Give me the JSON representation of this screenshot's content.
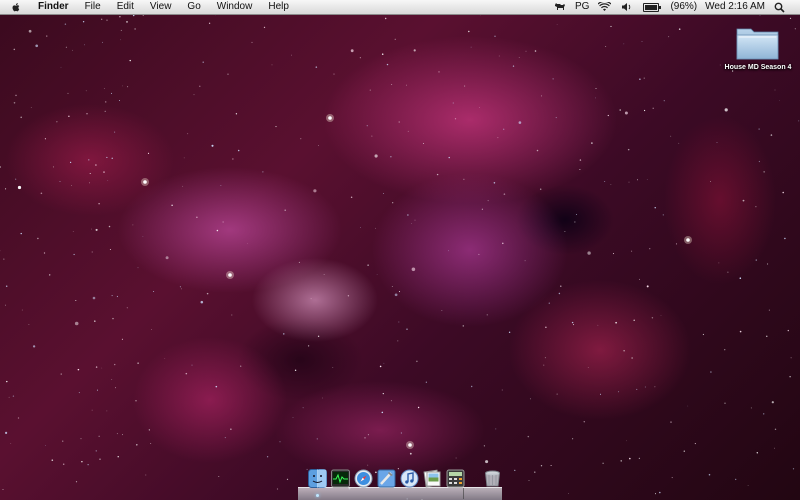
{
  "menubar": {
    "apple_icon": "apple-logo-icon",
    "items": [
      {
        "label": "Finder",
        "bold": true
      },
      {
        "label": "File"
      },
      {
        "label": "Edit"
      },
      {
        "label": "View"
      },
      {
        "label": "Go"
      },
      {
        "label": "Window"
      },
      {
        "label": "Help"
      }
    ],
    "status": {
      "dog_icon": "dog-icon",
      "input_label": "PG",
      "wifi_icon": "wifi-icon",
      "volume_icon": "volume-icon",
      "battery_icon": "battery-icon",
      "battery_level": 0.96,
      "battery_text": "(96%)",
      "clock": "Wed 2:16 AM",
      "spotlight_icon": "spotlight-search-icon"
    }
  },
  "desktop": {
    "folder": {
      "icon": "folder-icon",
      "label": "House MD Season 4"
    }
  },
  "dock": {
    "apps": [
      {
        "name": "finder-icon",
        "running": true
      },
      {
        "name": "activity-monitor-icon",
        "running": false
      },
      {
        "name": "safari-icon",
        "running": false
      },
      {
        "name": "xcode-icon",
        "running": false
      },
      {
        "name": "itunes-icon",
        "running": false
      },
      {
        "name": "preview-icon",
        "running": false
      },
      {
        "name": "calculator-icon",
        "running": false
      }
    ],
    "trash_icon": "trash-icon"
  },
  "colors": {
    "menubar_bg": "#e8e8e8",
    "nebula_magenta": "#c8347e",
    "space_dark": "#1a0510"
  }
}
